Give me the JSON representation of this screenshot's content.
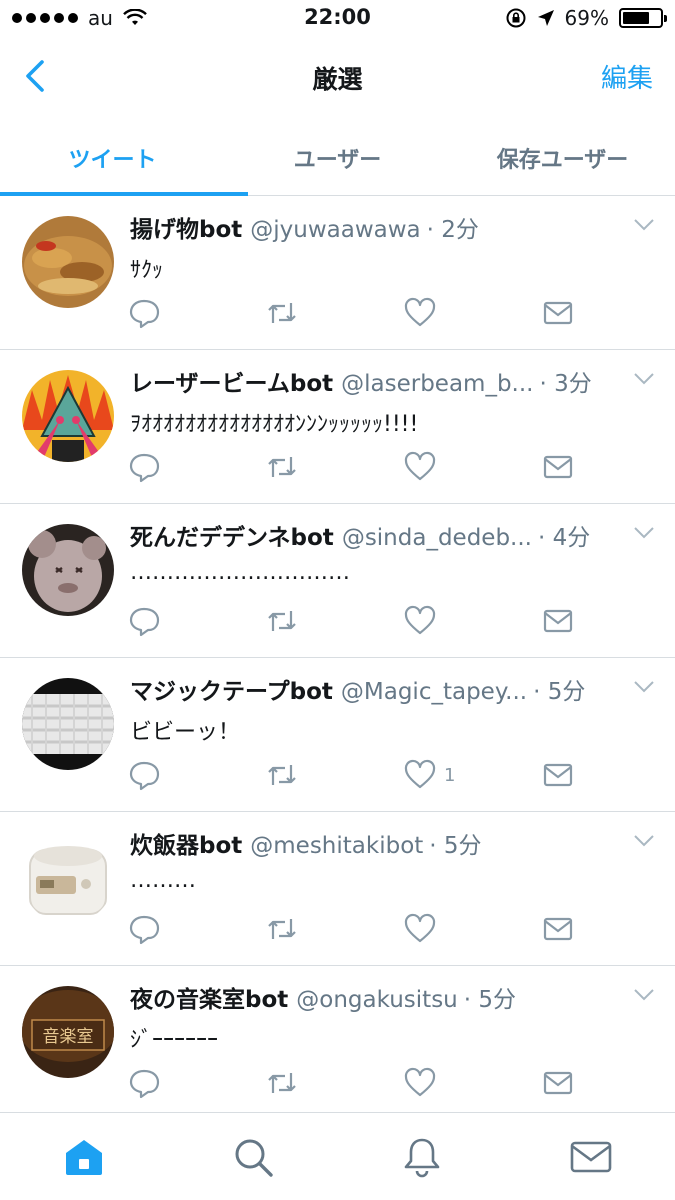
{
  "status_bar": {
    "carrier": "au",
    "time": "22:00",
    "battery": "69%"
  },
  "nav": {
    "title": "厳選",
    "edit_label": "編集"
  },
  "tabs": [
    {
      "label": "ツイート",
      "active": true
    },
    {
      "label": "ユーザー",
      "active": false
    },
    {
      "label": "保存ユーザー",
      "active": false
    }
  ],
  "tweets": [
    {
      "name": "揚げ物bot",
      "handle": "@jyuwaawawa",
      "time": "· 2分",
      "text": "ｻｸｯ",
      "like_count": ""
    },
    {
      "name": "レーザービームbot",
      "handle": "@laserbeam_b...",
      "time": "· 3分",
      "text": "ｦｵｵｵｵｵｵｵｵｵｵｵｵｵｵﾝﾝﾝｯｯｯｯｯ!!!!",
      "like_count": ""
    },
    {
      "name": "死んだデデンネbot",
      "handle": "@sinda_dedeb...",
      "time": "· 4分",
      "text": "…………………………",
      "like_count": ""
    },
    {
      "name": "マジックテープbot",
      "handle": "@Magic_tapey...",
      "time": "· 5分",
      "text": "ビビーッ！",
      "like_count": "1"
    },
    {
      "name": "炊飯器bot",
      "handle": "@meshitakibot",
      "time": "· 5分",
      "text": "………",
      "like_count": ""
    },
    {
      "name": "夜の音楽室bot",
      "handle": "@ongakusitsu",
      "time": "· 5分",
      "text": "ｼﾞｰｰｰｰｰｰ",
      "like_count": ""
    }
  ],
  "avatar_overlay_text": "音楽室",
  "colors": {
    "accent": "#1da1f2",
    "secondary_text": "#657786",
    "divider": "#d8dde1"
  },
  "icons": [
    "back-chevron-icon",
    "reply-icon",
    "retweet-icon",
    "like-icon",
    "dm-icon",
    "chevron-down-icon",
    "home-icon",
    "search-icon",
    "notifications-icon",
    "messages-icon"
  ]
}
